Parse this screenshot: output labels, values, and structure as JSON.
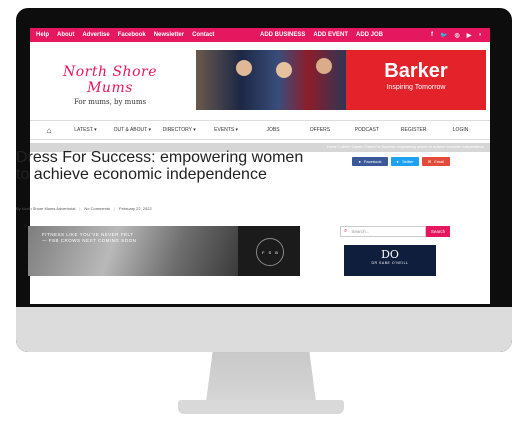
{
  "topbar": {
    "links": [
      "Help",
      "About",
      "Advertise",
      "Facebook",
      "Newsletter",
      "Contact"
    ],
    "actions": [
      "ADD BUSINESS",
      "ADD EVENT",
      "ADD JOB"
    ],
    "social": [
      "f",
      "🐦",
      "◎",
      "▶",
      "◗"
    ]
  },
  "header": {
    "logo_script": "North Shore Mums",
    "logo_tagline": "For mums, by mums",
    "ad_brand": "Barker",
    "ad_tagline": "Inspiring Tomorrow"
  },
  "nav": {
    "home_icon": "⌂",
    "items": [
      "LATEST ▾",
      "OUT & ABOUT ▾",
      "DIRECTORY ▾",
      "EVENTS ▾",
      "JOBS",
      "OFFERS",
      "PODCAST",
      "REGISTER",
      "LOGIN"
    ]
  },
  "breadcrumb": "Home / Latest / Career / Dress For Success: empowering women to achieve economic independence",
  "article": {
    "title": "Dress For Success: empowering women to achieve economic independence",
    "author": "By North Shore Mums Advertorial",
    "comments": "No Comments",
    "date": "February 22, 2022"
  },
  "share": {
    "facebook": "Facebook",
    "twitter": "Twitter",
    "email": "Email"
  },
  "video": {
    "caption_line1": "FITNESS LIKE YOU'VE NEVER FELT",
    "caption_line2": "— FSB CROWS NEST COMING SOON",
    "badge_letters": [
      "F",
      "S",
      "B"
    ]
  },
  "sidebar": {
    "search_placeholder": "Search...",
    "search_button": "Search",
    "ad_monogram": "DO",
    "ad_name": "DR SABE O'NEILL"
  },
  "colors": {
    "brand_pink": "#e5175f",
    "barker_red": "#e4222a",
    "facebook_blue": "#3b5998",
    "twitter_blue": "#1da1f2",
    "email_red": "#e54b3b"
  }
}
